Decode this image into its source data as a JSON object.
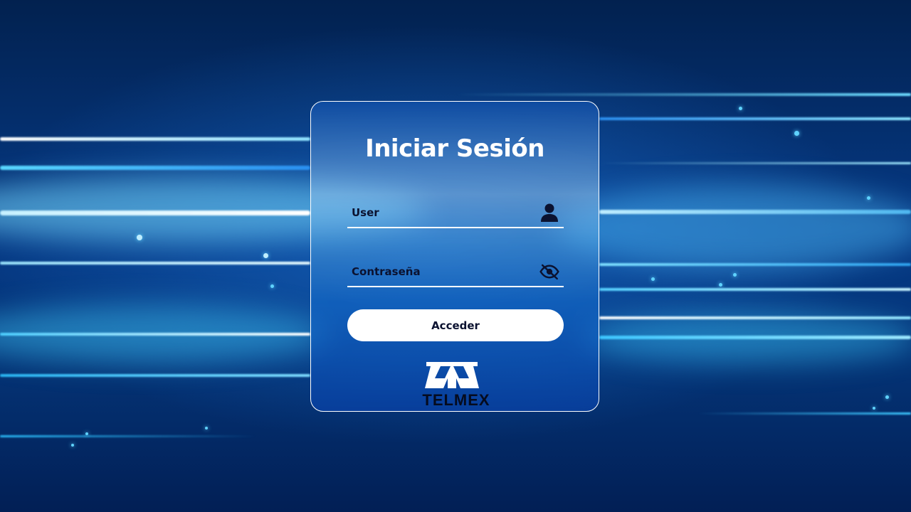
{
  "login": {
    "title": "Iniciar Sesión",
    "user_placeholder": "User",
    "password_placeholder": "Contraseña",
    "submit_label": "Acceder"
  },
  "brand": {
    "logo_text": "TELMEX"
  },
  "icons": {
    "user_field": "user-icon",
    "password_field": "eye-off-icon"
  },
  "colors": {
    "background": "#03265f",
    "accent": "#5fd3ff",
    "button": "#ffffff",
    "text_dark": "#0b1230"
  }
}
